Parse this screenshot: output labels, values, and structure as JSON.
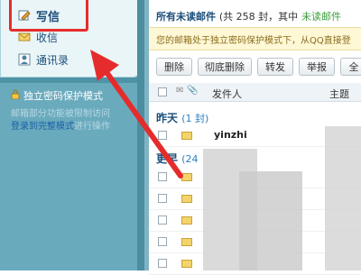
{
  "sidebar": {
    "write_label": "写信",
    "inbox_label": "收信",
    "contacts_label": "通讯录",
    "protect_title": "独立密码保护模式",
    "protect_desc_line1": "邮箱部分功能被限制访问",
    "protect_desc_link": "登录到完整模式",
    "protect_desc_tail": "进行操作"
  },
  "main": {
    "title": "所有未读邮件",
    "count_text": "(共 258 封，其中",
    "unread_green": "未读邮件",
    "notice": "您的邮箱处于独立密码保护模式下，从QQ直接登",
    "toolbar": [
      "删除",
      "彻底删除",
      "转发",
      "举报",
      "全"
    ],
    "columns": {
      "sender": "发件人",
      "subject": "主题"
    },
    "groups": [
      {
        "label": "昨天",
        "count": "(1 封)"
      },
      {
        "label": "更早",
        "count": "(24"
      }
    ],
    "first_row_sender": "yinzhi"
  },
  "colors": {
    "accent": "#1a4e7a",
    "annotation": "#e52c2c",
    "sidebar": "#5aa0b4"
  }
}
